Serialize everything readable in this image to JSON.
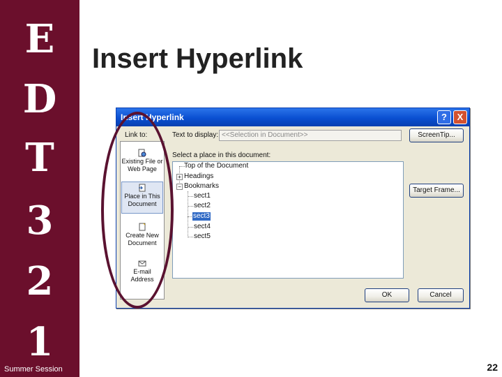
{
  "sidebar": {
    "letters": [
      "E",
      "D",
      "T",
      "3",
      "2",
      "1"
    ],
    "session_label": "Summer Session"
  },
  "slide": {
    "title": "Insert Hyperlink",
    "page_number": "22"
  },
  "dialog": {
    "title": "Insert Hyperlink",
    "help_glyph": "?",
    "close_glyph": "X",
    "link_to_label": "Link to:",
    "text_to_display_label": "Text to display:",
    "text_to_display_value": "<<Selection in Document>>",
    "screentip_button": "ScreenTip...",
    "select_place_label": "Select a place in this document:",
    "target_frame_button": "Target Frame...",
    "ok_button": "OK",
    "cancel_button": "Cancel",
    "link_options": [
      {
        "label": "Existing File or Web Page",
        "icon": "globe-page-icon"
      },
      {
        "label": "Place in This Document",
        "icon": "document-place-icon",
        "selected": true
      },
      {
        "label": "Create New Document",
        "icon": "new-document-icon"
      },
      {
        "label": "E-mail Address",
        "icon": "email-icon"
      }
    ],
    "tree": {
      "top": "Top of the Document",
      "headings": "Headings",
      "bookmarks": "Bookmarks",
      "bookmark_items": [
        "sect1",
        "sect2",
        "sect3",
        "sect4",
        "sect5"
      ],
      "selected_item": "sect3",
      "expand_glyph": "+",
      "collapse_glyph": "−"
    }
  },
  "colors": {
    "sidebar": "#6b0f2c",
    "annotation_oval": "#5a1230",
    "dialog_titlebar": "#0a4fd1",
    "selection": "#316ac5"
  }
}
